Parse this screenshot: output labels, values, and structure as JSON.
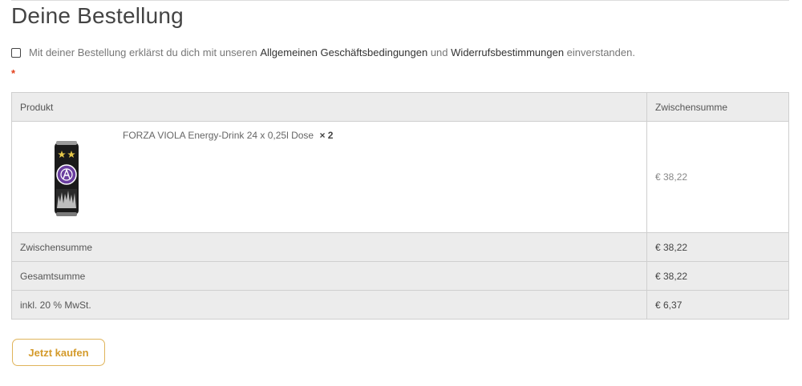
{
  "page": {
    "title": "Deine Bestellung"
  },
  "terms": {
    "text_before": "Mit deiner Bestellung erklärst du dich mit unseren",
    "link_agb": "Allgemeinen Geschäftsbedingungen",
    "text_middle": "und",
    "link_widerruf": "Widerrufsbestimmungen",
    "text_after": "einverstanden.",
    "checked": false,
    "required_marker": "*"
  },
  "table": {
    "columns": {
      "product": "Produkt",
      "subtotal": "Zwischensumme"
    },
    "items": [
      {
        "name": "FORZA VIOLA Energy-Drink 24 x 0,25l Dose",
        "quantity": "× 2",
        "subtotal": "€ 38,22",
        "image_icon": "energy-drink-can-icon"
      }
    ],
    "totals": [
      {
        "label": "Zwischensumme",
        "value": "€ 38,22"
      },
      {
        "label": "Gesamtsumme",
        "value": "€ 38,22"
      },
      {
        "label": "inkl. 20 % MwSt.",
        "value": "€ 6,37"
      }
    ]
  },
  "actions": {
    "buy_label": "Jetzt kaufen"
  },
  "colors": {
    "accent": "#d49a2a",
    "required": "#e2401c",
    "table_header_bg": "#ececec",
    "table_border": "#cfcfcf",
    "can_purple": "#6b3fa0"
  }
}
